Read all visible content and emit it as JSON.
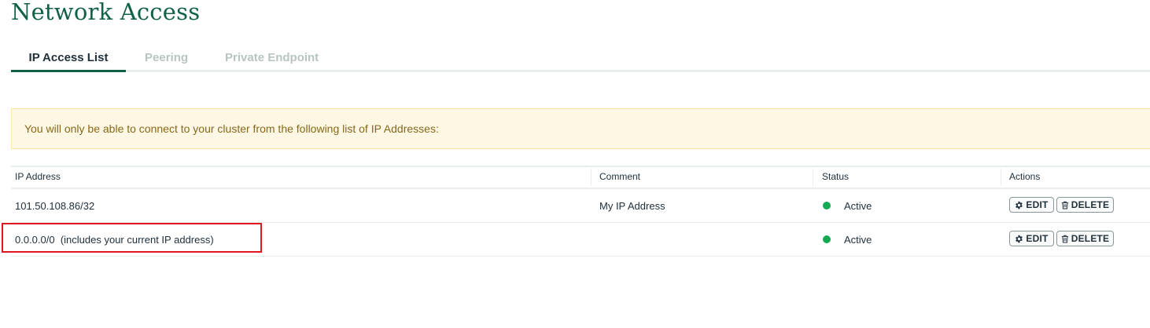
{
  "page": {
    "title": "Network Access"
  },
  "tabs": [
    {
      "label": "IP Access List",
      "active": true
    },
    {
      "label": "Peering",
      "active": false
    },
    {
      "label": "Private Endpoint",
      "active": false
    }
  ],
  "banner": {
    "text": "You will only be able to connect to your cluster from the following list of IP Addresses:"
  },
  "table": {
    "headers": {
      "ip": "IP Address",
      "comment": "Comment",
      "status": "Status",
      "actions": "Actions"
    },
    "rows": [
      {
        "ip": "101.50.108.86/32",
        "comment": "My IP Address",
        "status": "Active",
        "edit": "EDIT",
        "delete": "DELETE"
      },
      {
        "ip": "0.0.0.0/0  (includes your current IP address)",
        "comment": "",
        "status": "Active",
        "edit": "EDIT",
        "delete": "DELETE"
      }
    ]
  },
  "colors": {
    "brand_green": "#116149",
    "status_active": "#13aa52",
    "banner_bg": "#fef7e3",
    "highlight": "#e0181e"
  },
  "icons": {
    "edit": "gear-icon",
    "delete": "trash-icon"
  }
}
